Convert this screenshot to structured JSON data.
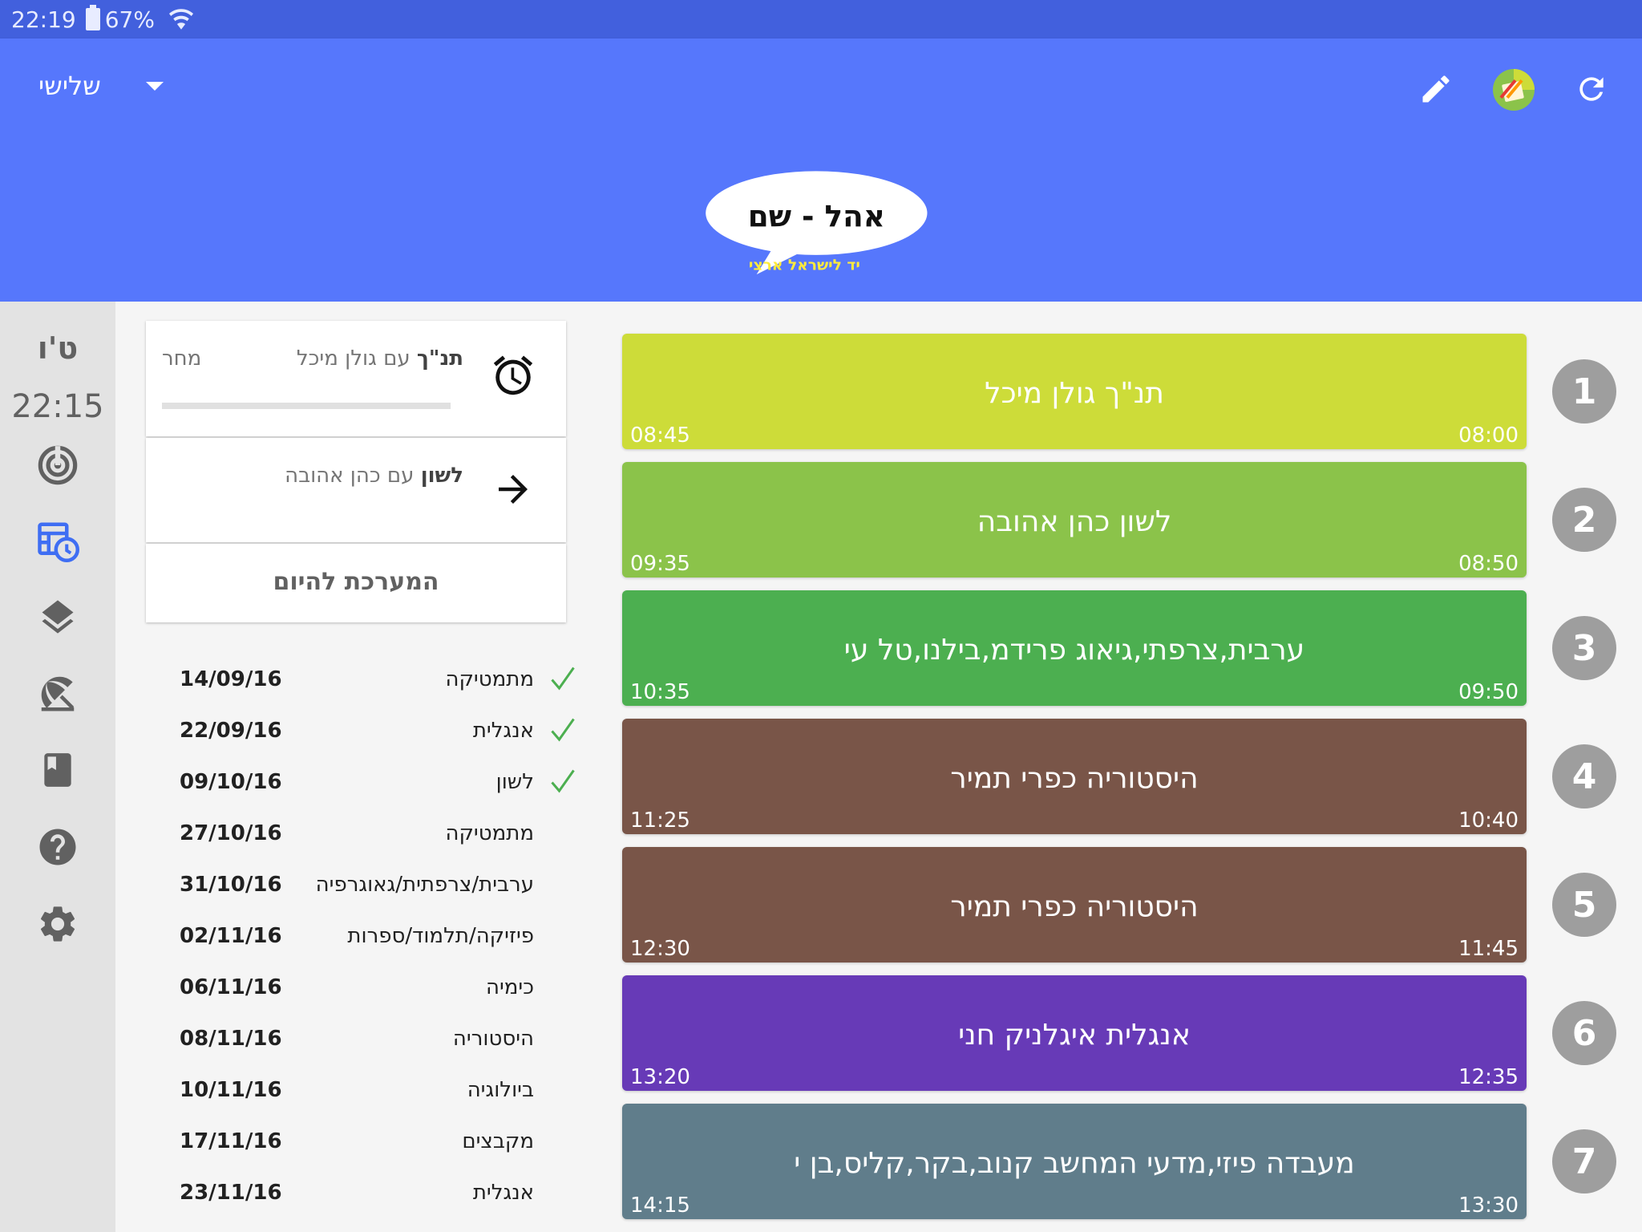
{
  "status_bar": {
    "time": "22:19",
    "battery": "67%"
  },
  "app_bar": {
    "day_selector": "שלישי",
    "icons": [
      "edit-icon",
      "planner-icon",
      "refresh-icon"
    ]
  },
  "banner": {
    "logo_text": "אהל - שם",
    "slogan": "יד לישראל ארצי"
  },
  "rail": {
    "day": "ט'ו",
    "time": "22:15",
    "items": [
      "dashboard-icon",
      "schedule-icon",
      "layers-icon",
      "vacation-icon",
      "book-icon",
      "help-icon",
      "settings-icon"
    ]
  },
  "next_lesson": {
    "subject": "תנ\"ך",
    "rest": "עם גולן מיכל",
    "when": "מחר"
  },
  "following_lesson": {
    "subject": "לשון",
    "rest": "עם כהן אהובה"
  },
  "today_schedule_label": "המערכת להיום",
  "exams": [
    {
      "subject": "מתמטיקה",
      "date": "14/09/16",
      "done": true
    },
    {
      "subject": "אנגלית",
      "date": "22/09/16",
      "done": true
    },
    {
      "subject": "לשון",
      "date": "09/10/16",
      "done": true
    },
    {
      "subject": "מתמטיקה",
      "date": "27/10/16",
      "done": false
    },
    {
      "subject": "ערבית/צרפתית/גאוגרפיה",
      "date": "31/10/16",
      "done": false
    },
    {
      "subject": "פיזיקה/תלמוד/ספרות",
      "date": "02/11/16",
      "done": false
    },
    {
      "subject": "כימיה",
      "date": "06/11/16",
      "done": false
    },
    {
      "subject": "היסטוריה",
      "date": "08/11/16",
      "done": false
    },
    {
      "subject": "ביולוגיה",
      "date": "10/11/16",
      "done": false
    },
    {
      "subject": "מקבצים",
      "date": "17/11/16",
      "done": false
    },
    {
      "subject": "אנגלית",
      "date": "23/11/16",
      "done": false
    }
  ],
  "lessons": [
    {
      "num": "1",
      "title": "תנ\"ך גולן מיכל",
      "start": "08:00",
      "end": "08:45",
      "color": "#cddc39"
    },
    {
      "num": "2",
      "title": "לשון כהן אהובה",
      "start": "08:50",
      "end": "09:35",
      "color": "#8bc34a"
    },
    {
      "num": "3",
      "title": "ערבית,צרפתי,גיאוג פרידמ,בילנו,טל עי",
      "start": "09:50",
      "end": "10:35",
      "color": "#4caf50"
    },
    {
      "num": "4",
      "title": "היסטוריה כפרי תמיר",
      "start": "10:40",
      "end": "11:25",
      "color": "#795548"
    },
    {
      "num": "5",
      "title": "היסטוריה כפרי תמיר",
      "start": "11:45",
      "end": "12:30",
      "color": "#795548"
    },
    {
      "num": "6",
      "title": "אנגלית איגלניק חני",
      "start": "12:35",
      "end": "13:20",
      "color": "#673ab7"
    },
    {
      "num": "7",
      "title": "מעבדה פיזי,מדעי המחשב קנוב,בקר,קליס,בן י",
      "start": "13:30",
      "end": "14:15",
      "color": "#607d8b"
    }
  ]
}
